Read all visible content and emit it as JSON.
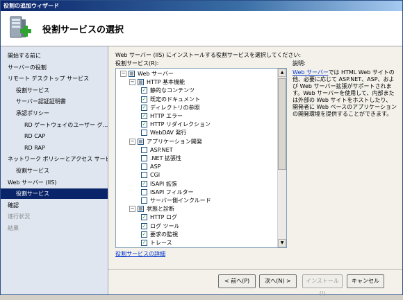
{
  "window": {
    "title": "役割の追加ウィザード"
  },
  "header": {
    "title": "役割サービスの選択"
  },
  "nav": {
    "items": [
      {
        "label": "開始する前に",
        "indent": 0,
        "state": "normal"
      },
      {
        "label": "サーバーの役割",
        "indent": 0,
        "state": "normal"
      },
      {
        "label": "リモート デスクトップ サービス",
        "indent": 0,
        "state": "normal"
      },
      {
        "label": "役割サービス",
        "indent": 1,
        "state": "normal"
      },
      {
        "label": "サーバー認証証明書",
        "indent": 1,
        "state": "normal"
      },
      {
        "label": "承認ポリシー",
        "indent": 1,
        "state": "normal"
      },
      {
        "label": "RD ゲートウェイのユーザー グ...",
        "indent": 2,
        "state": "normal"
      },
      {
        "label": "RD CAP",
        "indent": 2,
        "state": "normal"
      },
      {
        "label": "RD RAP",
        "indent": 2,
        "state": "normal"
      },
      {
        "label": "ネットワーク ポリシーとアクセス サービ...",
        "indent": 0,
        "state": "normal"
      },
      {
        "label": "役割サービス",
        "indent": 1,
        "state": "normal"
      },
      {
        "label": "Web サーバー (IIS)",
        "indent": 0,
        "state": "normal"
      },
      {
        "label": "役割サービス",
        "indent": 1,
        "state": "active"
      },
      {
        "label": "確認",
        "indent": 0,
        "state": "normal"
      },
      {
        "label": "進行状況",
        "indent": 0,
        "state": "dim"
      },
      {
        "label": "結果",
        "indent": 0,
        "state": "dim"
      }
    ]
  },
  "main": {
    "instruction": "Web サーバー (IIS) にインストールする役割サービスを選択してください:",
    "tree_label": "役割サービス(R):",
    "tree": [
      {
        "label": "Web サーバー",
        "level": 0,
        "expander": "−",
        "check": "partial"
      },
      {
        "label": "HTTP 基本機能",
        "level": 1,
        "expander": "−",
        "check": "partial"
      },
      {
        "label": "静的なコンテンツ",
        "level": 2,
        "expander": "",
        "check": "checked"
      },
      {
        "label": "既定のドキュメント",
        "level": 2,
        "expander": "",
        "check": "checked"
      },
      {
        "label": "ディレクトリの参照",
        "level": 2,
        "expander": "",
        "check": "checked"
      },
      {
        "label": "HTTP エラー",
        "level": 2,
        "expander": "",
        "check": "checked"
      },
      {
        "label": "HTTP リダイレクション",
        "level": 2,
        "expander": "",
        "check": "checked"
      },
      {
        "label": "WebDAV 発行",
        "level": 2,
        "expander": "",
        "check": "unchecked"
      },
      {
        "label": "アプリケーション開発",
        "level": 1,
        "expander": "−",
        "check": "partial"
      },
      {
        "label": "ASP.NET",
        "level": 2,
        "expander": "",
        "check": "unchecked"
      },
      {
        "label": ".NET 拡張性",
        "level": 2,
        "expander": "",
        "check": "unchecked"
      },
      {
        "label": "ASP",
        "level": 2,
        "expander": "",
        "check": "unchecked"
      },
      {
        "label": "CGI",
        "level": 2,
        "expander": "",
        "check": "unchecked"
      },
      {
        "label": "ISAPI 拡張",
        "level": 2,
        "expander": "",
        "check": "checked"
      },
      {
        "label": "ISAPI フィルター",
        "level": 2,
        "expander": "",
        "check": "unchecked"
      },
      {
        "label": "サーバー側インクルード",
        "level": 2,
        "expander": "",
        "check": "unchecked"
      },
      {
        "label": "状態と診断",
        "level": 1,
        "expander": "−",
        "check": "partial"
      },
      {
        "label": "HTTP ログ",
        "level": 2,
        "expander": "",
        "check": "checked"
      },
      {
        "label": "ログ ツール",
        "level": 2,
        "expander": "",
        "check": "checked"
      },
      {
        "label": "要求の監視",
        "level": 2,
        "expander": "",
        "check": "checked"
      },
      {
        "label": "トレース",
        "level": 2,
        "expander": "",
        "check": "checked"
      }
    ],
    "more_link": "役割サービスの詳細",
    "description_title": "説明:",
    "description_link": "Web サーバー",
    "description_text": "では HTML Web サイトの他、必要に応じて ASP.NET、ASP、および Web サーバー拡張がサポートされます。Web サーバーを使用して、内部または外部の Web サイトをホストしたり、開発者に Web ベースのアプリケーションの開発環境を提供することができます。"
  },
  "buttons": {
    "back": "< 前へ(P)",
    "next": "次へ(N) >",
    "install": "インストール(I)",
    "cancel": "キャンセル"
  },
  "icons": {
    "header": "server-add-icon",
    "check": "✓",
    "scroll_up": "▲",
    "scroll_down": "▼"
  }
}
